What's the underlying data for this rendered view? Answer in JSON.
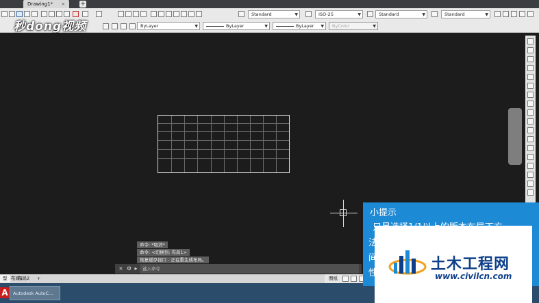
{
  "document_tabs": {
    "active": "Drawing1*",
    "new_tab": "+"
  },
  "toolbar": {
    "text_style": "Standard",
    "dim_style": "ISO-25",
    "table_style": "Standard",
    "multileader_style": "Standard",
    "layer_color": "ByLayer",
    "linetype": "ByLayer",
    "lineweight": "ByLayer",
    "plot_style": "ByColor"
  },
  "watermark": "秒dong视频",
  "command_history": [
    "命令: *取消*",
    "命令:   <切换到: 布局1>",
    "恢复缓存视口 - 正在重生成布局。"
  ],
  "command_input": {
    "prompt_icon": "▸",
    "placeholder": "键入命令"
  },
  "layout_tabs": [
    "型",
    "布局1",
    "布局2",
    "+"
  ],
  "status": {
    "paper_label": "图纸"
  },
  "taskbar": {
    "logo": "A",
    "app_label": "Autodesk AutoC..."
  },
  "tip": {
    "title": "小提示",
    "line1": "只是选择1/1以上的版本布局下方",
    "line2a": "法",
    "line2b": "间",
    "line2c": "性"
  },
  "logo": {
    "cn": "土木工程网",
    "url": "www.civilcn.com"
  },
  "colors": {
    "canvas": "#1c1c1c",
    "tip_blue": "#1d8ad6",
    "logo_blue": "#0d3f8a"
  }
}
